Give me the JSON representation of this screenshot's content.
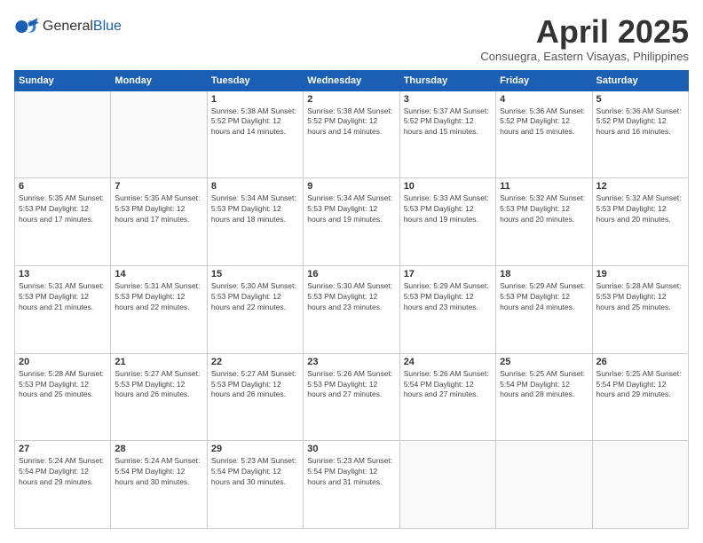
{
  "header": {
    "logo_general": "General",
    "logo_blue": "Blue",
    "month_title": "April 2025",
    "location": "Consuegra, Eastern Visayas, Philippines"
  },
  "weekdays": [
    "Sunday",
    "Monday",
    "Tuesday",
    "Wednesday",
    "Thursday",
    "Friday",
    "Saturday"
  ],
  "weeks": [
    [
      {
        "day": "",
        "info": ""
      },
      {
        "day": "",
        "info": ""
      },
      {
        "day": "1",
        "info": "Sunrise: 5:38 AM\nSunset: 5:52 PM\nDaylight: 12 hours\nand 14 minutes."
      },
      {
        "day": "2",
        "info": "Sunrise: 5:38 AM\nSunset: 5:52 PM\nDaylight: 12 hours\nand 14 minutes."
      },
      {
        "day": "3",
        "info": "Sunrise: 5:37 AM\nSunset: 5:52 PM\nDaylight: 12 hours\nand 15 minutes."
      },
      {
        "day": "4",
        "info": "Sunrise: 5:36 AM\nSunset: 5:52 PM\nDaylight: 12 hours\nand 15 minutes."
      },
      {
        "day": "5",
        "info": "Sunrise: 5:36 AM\nSunset: 5:52 PM\nDaylight: 12 hours\nand 16 minutes."
      }
    ],
    [
      {
        "day": "6",
        "info": "Sunrise: 5:35 AM\nSunset: 5:53 PM\nDaylight: 12 hours\nand 17 minutes."
      },
      {
        "day": "7",
        "info": "Sunrise: 5:35 AM\nSunset: 5:53 PM\nDaylight: 12 hours\nand 17 minutes."
      },
      {
        "day": "8",
        "info": "Sunrise: 5:34 AM\nSunset: 5:53 PM\nDaylight: 12 hours\nand 18 minutes."
      },
      {
        "day": "9",
        "info": "Sunrise: 5:34 AM\nSunset: 5:53 PM\nDaylight: 12 hours\nand 19 minutes."
      },
      {
        "day": "10",
        "info": "Sunrise: 5:33 AM\nSunset: 5:53 PM\nDaylight: 12 hours\nand 19 minutes."
      },
      {
        "day": "11",
        "info": "Sunrise: 5:32 AM\nSunset: 5:53 PM\nDaylight: 12 hours\nand 20 minutes."
      },
      {
        "day": "12",
        "info": "Sunrise: 5:32 AM\nSunset: 5:53 PM\nDaylight: 12 hours\nand 20 minutes."
      }
    ],
    [
      {
        "day": "13",
        "info": "Sunrise: 5:31 AM\nSunset: 5:53 PM\nDaylight: 12 hours\nand 21 minutes."
      },
      {
        "day": "14",
        "info": "Sunrise: 5:31 AM\nSunset: 5:53 PM\nDaylight: 12 hours\nand 22 minutes."
      },
      {
        "day": "15",
        "info": "Sunrise: 5:30 AM\nSunset: 5:53 PM\nDaylight: 12 hours\nand 22 minutes."
      },
      {
        "day": "16",
        "info": "Sunrise: 5:30 AM\nSunset: 5:53 PM\nDaylight: 12 hours\nand 23 minutes."
      },
      {
        "day": "17",
        "info": "Sunrise: 5:29 AM\nSunset: 5:53 PM\nDaylight: 12 hours\nand 23 minutes."
      },
      {
        "day": "18",
        "info": "Sunrise: 5:29 AM\nSunset: 5:53 PM\nDaylight: 12 hours\nand 24 minutes."
      },
      {
        "day": "19",
        "info": "Sunrise: 5:28 AM\nSunset: 5:53 PM\nDaylight: 12 hours\nand 25 minutes."
      }
    ],
    [
      {
        "day": "20",
        "info": "Sunrise: 5:28 AM\nSunset: 5:53 PM\nDaylight: 12 hours\nand 25 minutes."
      },
      {
        "day": "21",
        "info": "Sunrise: 5:27 AM\nSunset: 5:53 PM\nDaylight: 12 hours\nand 26 minutes."
      },
      {
        "day": "22",
        "info": "Sunrise: 5:27 AM\nSunset: 5:53 PM\nDaylight: 12 hours\nand 26 minutes."
      },
      {
        "day": "23",
        "info": "Sunrise: 5:26 AM\nSunset: 5:53 PM\nDaylight: 12 hours\nand 27 minutes."
      },
      {
        "day": "24",
        "info": "Sunrise: 5:26 AM\nSunset: 5:54 PM\nDaylight: 12 hours\nand 27 minutes."
      },
      {
        "day": "25",
        "info": "Sunrise: 5:25 AM\nSunset: 5:54 PM\nDaylight: 12 hours\nand 28 minutes."
      },
      {
        "day": "26",
        "info": "Sunrise: 5:25 AM\nSunset: 5:54 PM\nDaylight: 12 hours\nand 29 minutes."
      }
    ],
    [
      {
        "day": "27",
        "info": "Sunrise: 5:24 AM\nSunset: 5:54 PM\nDaylight: 12 hours\nand 29 minutes."
      },
      {
        "day": "28",
        "info": "Sunrise: 5:24 AM\nSunset: 5:54 PM\nDaylight: 12 hours\nand 30 minutes."
      },
      {
        "day": "29",
        "info": "Sunrise: 5:23 AM\nSunset: 5:54 PM\nDaylight: 12 hours\nand 30 minutes."
      },
      {
        "day": "30",
        "info": "Sunrise: 5:23 AM\nSunset: 5:54 PM\nDaylight: 12 hours\nand 31 minutes."
      },
      {
        "day": "",
        "info": ""
      },
      {
        "day": "",
        "info": ""
      },
      {
        "day": "",
        "info": ""
      }
    ]
  ]
}
